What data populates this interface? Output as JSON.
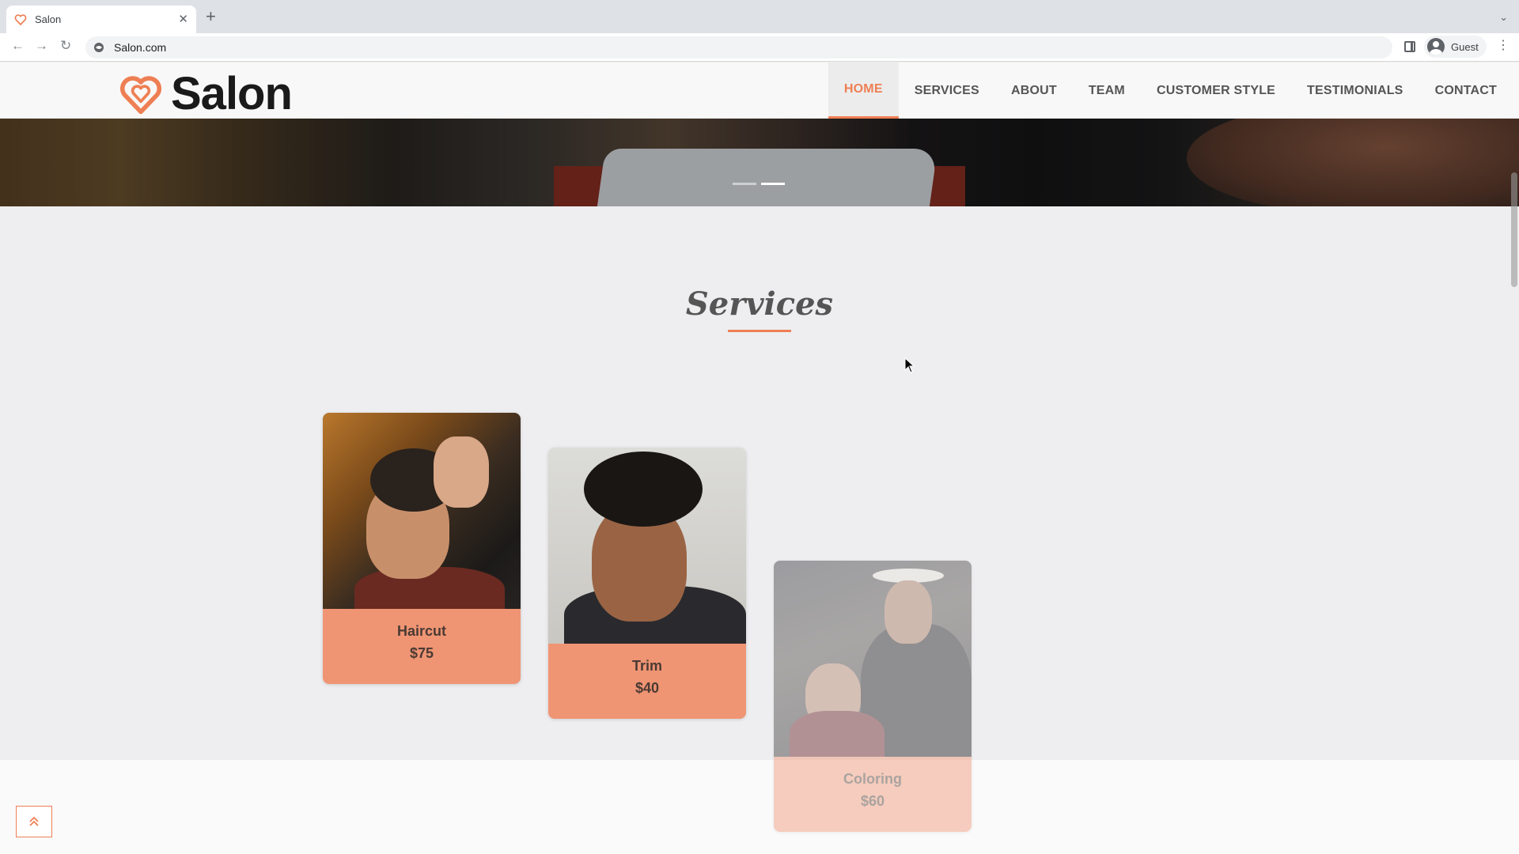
{
  "browser": {
    "tab_title": "Salon",
    "url": "Salon.com",
    "profile_name": "Guest"
  },
  "site": {
    "logo_text": "Salon",
    "nav": [
      {
        "label": "HOME",
        "active": true
      },
      {
        "label": "SERVICES",
        "active": false
      },
      {
        "label": "ABOUT",
        "active": false
      },
      {
        "label": "TEAM",
        "active": false
      },
      {
        "label": "CUSTOMER STYLE",
        "active": false
      },
      {
        "label": "TESTIMONIALS",
        "active": false
      },
      {
        "label": "CONTACT",
        "active": false
      }
    ]
  },
  "hero": {
    "slide_count": 2,
    "active_slide": 2
  },
  "services": {
    "title": "Services",
    "items": [
      {
        "name": "Haircut",
        "price": "$75"
      },
      {
        "name": "Trim",
        "price": "$40"
      },
      {
        "name": "Coloring",
        "price": "$60"
      }
    ]
  },
  "colors": {
    "accent": "#ee7f54",
    "card_body": "#ef9574",
    "page_bg": "#eeeef0"
  },
  "icons": {
    "back_to_top": "double-chevron-up-icon"
  }
}
